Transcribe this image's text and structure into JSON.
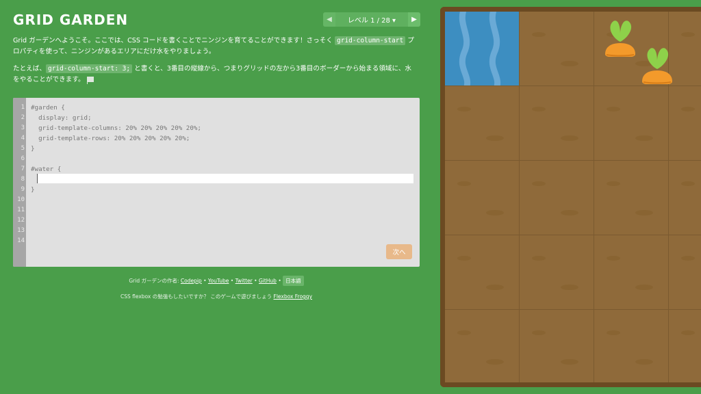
{
  "header": {
    "title": "GRID GARDEN",
    "level_label": "レベル 1 / 28 ▾",
    "prev_arrow": "◀",
    "next_arrow": "▶"
  },
  "instructions": {
    "para1_before": "Grid ガーデンへようこそ。ここでは、CSS コードを書くことでニンジンを育てることができます！さっそく ",
    "para1_code": "grid-column-start",
    "para1_after": " プロパティを使って、ニンジンがあるエリアにだけ水をやりましょう。",
    "para2_before": "たとえば、",
    "para2_code": "grid-column-start: 3;",
    "para2_after": " と書くと、3番目の縦線から、つまりグリッドの左から3番目のボーダーから始まる領域に、水をやることができます。"
  },
  "editor": {
    "line_numbers": [
      "1",
      "2",
      "3",
      "4",
      "5",
      "6",
      "7",
      "8",
      "9",
      "10",
      "11",
      "12",
      "13",
      "14"
    ],
    "lines": [
      "#garden {",
      "  display: grid;",
      "  grid-template-columns: 20% 20% 20% 20% 20%;",
      "  grid-template-rows: 20% 20% 20% 20% 20%;",
      "}",
      "",
      "#water {",
      "",
      "}"
    ],
    "input_value": "",
    "next_label": "次へ"
  },
  "footer": {
    "credits_prefix": "Grid ガーデンの作者: ",
    "links": [
      "Codepip",
      "YouTube",
      "Twitter",
      "GitHub"
    ],
    "separator": " • ",
    "language_label": "日本語",
    "promo_text": "CSS flexbox の勉強もしたいですか？ このゲームで遊びましょう ",
    "promo_link": "Flexbox Froggy"
  },
  "colors": {
    "background": "#4a9e4a",
    "water": "#3d8ec1",
    "soil": "#8f6a3a",
    "carrot": "#f39a2b",
    "leaf": "#8ed14a",
    "next_button": "#e8b98a"
  },
  "garden": {
    "columns": 5,
    "rows": 5,
    "water_cell": {
      "row": 1,
      "column": 1
    },
    "carrot_icon": "carrot-icon"
  }
}
